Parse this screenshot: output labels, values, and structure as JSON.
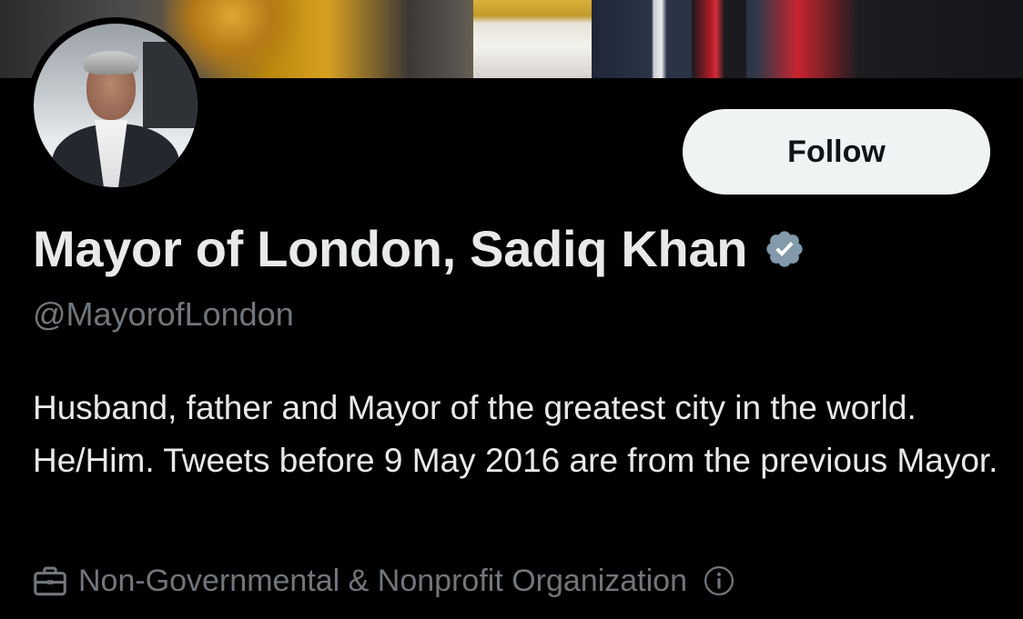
{
  "profile": {
    "display_name": "Mayor of London, Sadiq Khan",
    "handle": "@MayorofLondon",
    "verified_icon": "verified-badge-icon",
    "bio": "Husband, father and Mayor of the greatest city in the world. He/Him. Tweets before 9 May 2016 are from the previous Mayor.",
    "category": "Non-Governmental & Nonprofit Organization",
    "category_icon": "briefcase-icon",
    "info_icon": "info-icon"
  },
  "actions": {
    "follow_label": "Follow"
  },
  "colors": {
    "background": "#000000",
    "primary_text": "#e7e9ea",
    "secondary_text": "#71767b",
    "button_bg": "#eff3f4",
    "button_text": "#0f1419",
    "verified_badge": "#829aab"
  }
}
